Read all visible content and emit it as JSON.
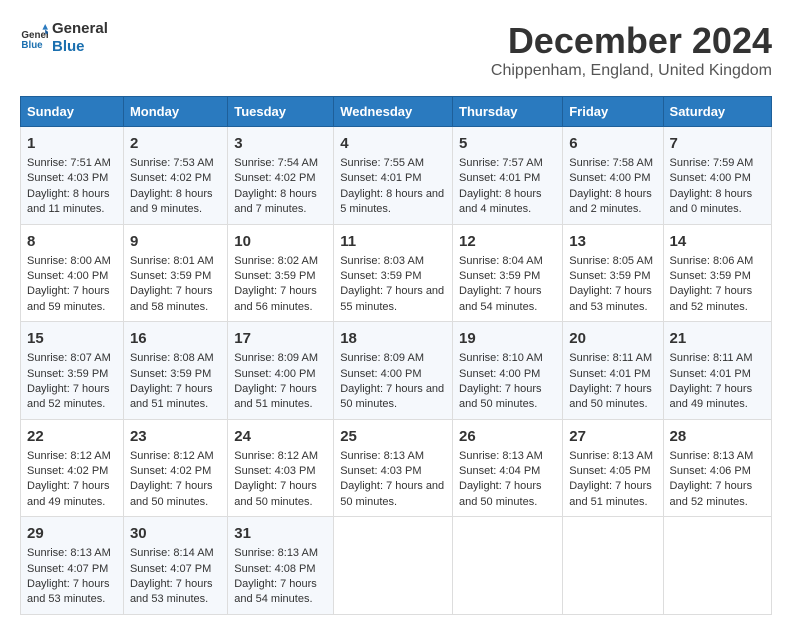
{
  "logo": {
    "line1": "General",
    "line2": "Blue"
  },
  "title": "December 2024",
  "subtitle": "Chippenham, England, United Kingdom",
  "days_of_week": [
    "Sunday",
    "Monday",
    "Tuesday",
    "Wednesday",
    "Thursday",
    "Friday",
    "Saturday"
  ],
  "weeks": [
    [
      {
        "day": "1",
        "sunrise": "Sunrise: 7:51 AM",
        "sunset": "Sunset: 4:03 PM",
        "daylight": "Daylight: 8 hours and 11 minutes."
      },
      {
        "day": "2",
        "sunrise": "Sunrise: 7:53 AM",
        "sunset": "Sunset: 4:02 PM",
        "daylight": "Daylight: 8 hours and 9 minutes."
      },
      {
        "day": "3",
        "sunrise": "Sunrise: 7:54 AM",
        "sunset": "Sunset: 4:02 PM",
        "daylight": "Daylight: 8 hours and 7 minutes."
      },
      {
        "day": "4",
        "sunrise": "Sunrise: 7:55 AM",
        "sunset": "Sunset: 4:01 PM",
        "daylight": "Daylight: 8 hours and 5 minutes."
      },
      {
        "day": "5",
        "sunrise": "Sunrise: 7:57 AM",
        "sunset": "Sunset: 4:01 PM",
        "daylight": "Daylight: 8 hours and 4 minutes."
      },
      {
        "day": "6",
        "sunrise": "Sunrise: 7:58 AM",
        "sunset": "Sunset: 4:00 PM",
        "daylight": "Daylight: 8 hours and 2 minutes."
      },
      {
        "day": "7",
        "sunrise": "Sunrise: 7:59 AM",
        "sunset": "Sunset: 4:00 PM",
        "daylight": "Daylight: 8 hours and 0 minutes."
      }
    ],
    [
      {
        "day": "8",
        "sunrise": "Sunrise: 8:00 AM",
        "sunset": "Sunset: 4:00 PM",
        "daylight": "Daylight: 7 hours and 59 minutes."
      },
      {
        "day": "9",
        "sunrise": "Sunrise: 8:01 AM",
        "sunset": "Sunset: 3:59 PM",
        "daylight": "Daylight: 7 hours and 58 minutes."
      },
      {
        "day": "10",
        "sunrise": "Sunrise: 8:02 AM",
        "sunset": "Sunset: 3:59 PM",
        "daylight": "Daylight: 7 hours and 56 minutes."
      },
      {
        "day": "11",
        "sunrise": "Sunrise: 8:03 AM",
        "sunset": "Sunset: 3:59 PM",
        "daylight": "Daylight: 7 hours and 55 minutes."
      },
      {
        "day": "12",
        "sunrise": "Sunrise: 8:04 AM",
        "sunset": "Sunset: 3:59 PM",
        "daylight": "Daylight: 7 hours and 54 minutes."
      },
      {
        "day": "13",
        "sunrise": "Sunrise: 8:05 AM",
        "sunset": "Sunset: 3:59 PM",
        "daylight": "Daylight: 7 hours and 53 minutes."
      },
      {
        "day": "14",
        "sunrise": "Sunrise: 8:06 AM",
        "sunset": "Sunset: 3:59 PM",
        "daylight": "Daylight: 7 hours and 52 minutes."
      }
    ],
    [
      {
        "day": "15",
        "sunrise": "Sunrise: 8:07 AM",
        "sunset": "Sunset: 3:59 PM",
        "daylight": "Daylight: 7 hours and 52 minutes."
      },
      {
        "day": "16",
        "sunrise": "Sunrise: 8:08 AM",
        "sunset": "Sunset: 3:59 PM",
        "daylight": "Daylight: 7 hours and 51 minutes."
      },
      {
        "day": "17",
        "sunrise": "Sunrise: 8:09 AM",
        "sunset": "Sunset: 4:00 PM",
        "daylight": "Daylight: 7 hours and 51 minutes."
      },
      {
        "day": "18",
        "sunrise": "Sunrise: 8:09 AM",
        "sunset": "Sunset: 4:00 PM",
        "daylight": "Daylight: 7 hours and 50 minutes."
      },
      {
        "day": "19",
        "sunrise": "Sunrise: 8:10 AM",
        "sunset": "Sunset: 4:00 PM",
        "daylight": "Daylight: 7 hours and 50 minutes."
      },
      {
        "day": "20",
        "sunrise": "Sunrise: 8:11 AM",
        "sunset": "Sunset: 4:01 PM",
        "daylight": "Daylight: 7 hours and 50 minutes."
      },
      {
        "day": "21",
        "sunrise": "Sunrise: 8:11 AM",
        "sunset": "Sunset: 4:01 PM",
        "daylight": "Daylight: 7 hours and 49 minutes."
      }
    ],
    [
      {
        "day": "22",
        "sunrise": "Sunrise: 8:12 AM",
        "sunset": "Sunset: 4:02 PM",
        "daylight": "Daylight: 7 hours and 49 minutes."
      },
      {
        "day": "23",
        "sunrise": "Sunrise: 8:12 AM",
        "sunset": "Sunset: 4:02 PM",
        "daylight": "Daylight: 7 hours and 50 minutes."
      },
      {
        "day": "24",
        "sunrise": "Sunrise: 8:12 AM",
        "sunset": "Sunset: 4:03 PM",
        "daylight": "Daylight: 7 hours and 50 minutes."
      },
      {
        "day": "25",
        "sunrise": "Sunrise: 8:13 AM",
        "sunset": "Sunset: 4:03 PM",
        "daylight": "Daylight: 7 hours and 50 minutes."
      },
      {
        "day": "26",
        "sunrise": "Sunrise: 8:13 AM",
        "sunset": "Sunset: 4:04 PM",
        "daylight": "Daylight: 7 hours and 50 minutes."
      },
      {
        "day": "27",
        "sunrise": "Sunrise: 8:13 AM",
        "sunset": "Sunset: 4:05 PM",
        "daylight": "Daylight: 7 hours and 51 minutes."
      },
      {
        "day": "28",
        "sunrise": "Sunrise: 8:13 AM",
        "sunset": "Sunset: 4:06 PM",
        "daylight": "Daylight: 7 hours and 52 minutes."
      }
    ],
    [
      {
        "day": "29",
        "sunrise": "Sunrise: 8:13 AM",
        "sunset": "Sunset: 4:07 PM",
        "daylight": "Daylight: 7 hours and 53 minutes."
      },
      {
        "day": "30",
        "sunrise": "Sunrise: 8:14 AM",
        "sunset": "Sunset: 4:07 PM",
        "daylight": "Daylight: 7 hours and 53 minutes."
      },
      {
        "day": "31",
        "sunrise": "Sunrise: 8:13 AM",
        "sunset": "Sunset: 4:08 PM",
        "daylight": "Daylight: 7 hours and 54 minutes."
      },
      null,
      null,
      null,
      null
    ]
  ]
}
